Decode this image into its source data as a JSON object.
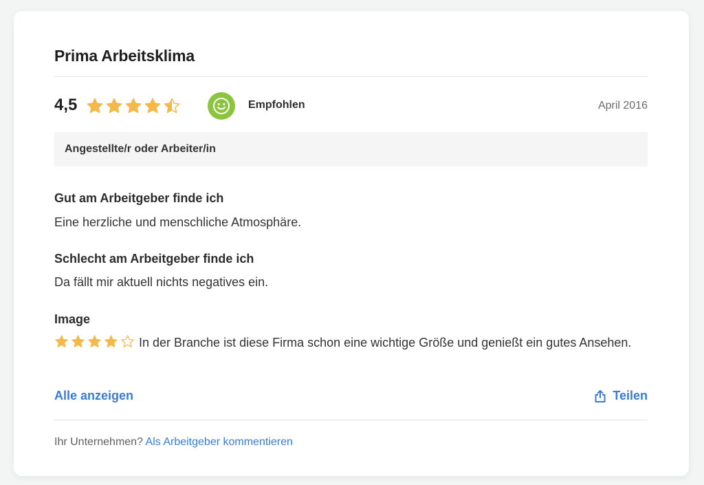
{
  "review": {
    "title": "Prima Arbeitsklima",
    "score": "4,5",
    "score_value": 4.5,
    "recommendation": "Empfohlen",
    "date": "April 2016",
    "role": "Angestellte/r oder Arbeiter/in"
  },
  "sections": {
    "good_heading": "Gut am Arbeitgeber finde ich",
    "good_text": "Eine herzliche und menschliche Atmosphäre.",
    "bad_heading": "Schlecht am Arbeitgeber finde ich",
    "bad_text": "Da fällt mir aktuell nichts negatives ein.",
    "image_heading": "Image",
    "image_rating": 4,
    "image_text": "In der Branche ist diese Firma schon eine wichtige Größe und genießt ein gutes Ansehen."
  },
  "actions": {
    "show_all": "Alle anzeigen",
    "share": "Teilen"
  },
  "footer": {
    "prompt": "Ihr Unternehmen?",
    "link": "Als Arbeitgeber kommentieren"
  },
  "colors": {
    "star": "#f5b94a",
    "star_empty_outline": "#f5b94a",
    "recommend": "#8cc43f",
    "link": "#3a7bd5"
  },
  "icons": {
    "recommend": "smiley-icon",
    "share": "share-icon",
    "star": "star-icon"
  }
}
